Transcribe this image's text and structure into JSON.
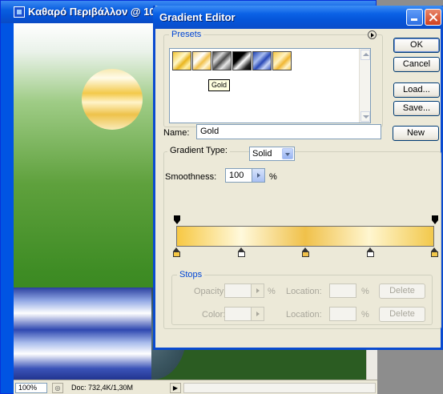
{
  "document": {
    "title": "Καθαρό Περιβάλλον @ 100%",
    "zoom": "100%",
    "doc_info": "Doc: 732,4K/1,30M"
  },
  "dialog": {
    "title": "Gradient Editor",
    "presets": {
      "legend": "Presets",
      "swatches": [
        {
          "name": "preset-1"
        },
        {
          "name": "preset-2"
        },
        {
          "name": "preset-3"
        },
        {
          "name": "preset-4"
        },
        {
          "name": "preset-5"
        },
        {
          "name": "preset-6"
        }
      ],
      "tooltip": "Gold"
    },
    "buttons": {
      "ok": "OK",
      "cancel": "Cancel",
      "load": "Load...",
      "save": "Save...",
      "new": "New"
    },
    "name_label": "Name:",
    "name_value": "Gold",
    "gradient_type_label": "Gradient Type:",
    "gradient_type_value": "Solid",
    "smoothness_label": "Smoothness:",
    "smoothness_value": "100",
    "smoothness_unit": "%",
    "gradient_colors": [
      "#f7c843",
      "#fff9dc",
      "#f0c14a",
      "#fff6d0",
      "#f2c84b"
    ],
    "color_stop_positions": [
      0,
      25,
      50,
      75,
      100
    ],
    "opacity_stop_positions": [
      0,
      100
    ],
    "stops": {
      "legend": "Stops",
      "opacity_label": "Opacity:",
      "color_label": "Color:",
      "location_label": "Location:",
      "percent": "%",
      "delete": "Delete"
    }
  }
}
